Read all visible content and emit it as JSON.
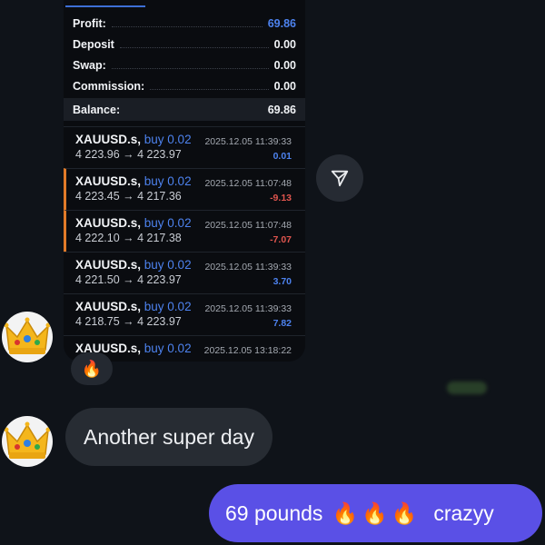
{
  "summary": {
    "rows": [
      {
        "label": "Profit:",
        "value": "69.86"
      },
      {
        "label": "Deposit",
        "value": "0.00"
      },
      {
        "label": "Swap:",
        "value": "0.00"
      },
      {
        "label": "Commission:",
        "value": "0.00"
      },
      {
        "label": "Balance:",
        "value": "69.86"
      }
    ]
  },
  "trades": [
    {
      "symbol": "XAUUSD.s,",
      "side": "buy 0.02",
      "prices": "4 223.96 → 4 223.97",
      "time": "2025.12.05 11:39:33",
      "pnl": "0.01"
    },
    {
      "symbol": "XAUUSD.s,",
      "side": "buy 0.02",
      "prices": "4 223.45 → 4 217.36",
      "time": "2025.12.05 11:07:48",
      "pnl": "-9.13"
    },
    {
      "symbol": "XAUUSD.s,",
      "side": "buy 0.02",
      "prices": "4 222.10 → 4 217.38",
      "time": "2025.12.05 11:07:48",
      "pnl": "-7.07"
    },
    {
      "symbol": "XAUUSD.s,",
      "side": "buy 0.02",
      "prices": "4 221.50 → 4 223.97",
      "time": "2025.12.05 11:39:33",
      "pnl": "3.70"
    },
    {
      "symbol": "XAUUSD.s,",
      "side": "buy 0.02",
      "prices": "4 218.75 → 4 223.97",
      "time": "2025.12.05 11:39:33",
      "pnl": "7.82"
    },
    {
      "symbol": "XAUUSD.s,",
      "side": "buy 0.02",
      "prices": "",
      "time": "2025.12.05 13:18:22",
      "pnl": ""
    }
  ],
  "reaction": {
    "emoji": "🔥"
  },
  "messages": {
    "incoming": "Another super day",
    "outgoing_text": "69 pounds",
    "outgoing_emojis": "🔥🔥🔥",
    "outgoing_tail": "crazyy"
  },
  "icons": {
    "share": "share-arrow-icon",
    "avatar": "crown-icon"
  },
  "colors": {
    "accent_blue": "#4d82ee",
    "loss_red": "#e0554e",
    "outgoing_bubble": "#5a50e6",
    "marker_orange": "#e07a28"
  }
}
